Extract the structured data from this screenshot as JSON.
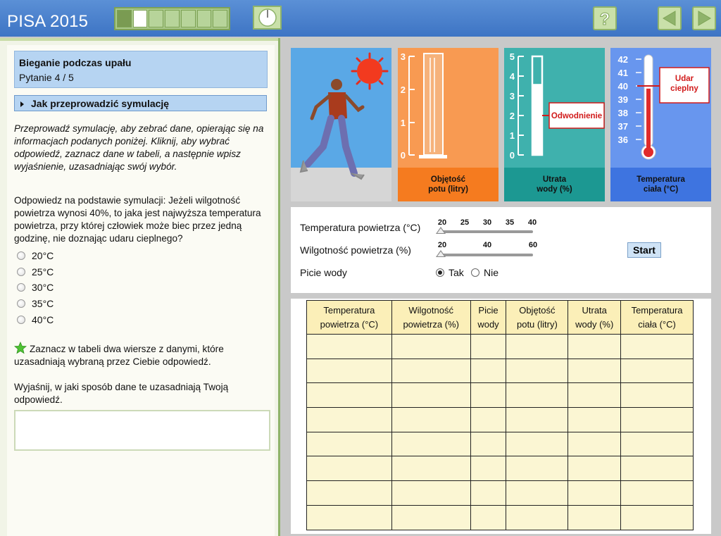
{
  "header": {
    "app_title": "PISA 2015",
    "progress": {
      "total_segments": 7,
      "completed": 1,
      "current": 2
    }
  },
  "left": {
    "title": "Bieganie podczas upału",
    "question_counter": "Pytanie 4 / 5",
    "howto_label": "Jak przeprowadzić symulację",
    "instructions": "Przeprowadź symulację, aby zebrać dane, opierając się na informacjach podanych poniżej. Kliknij, aby wybrać odpowiedź, zaznacz dane w tabeli, a następnie wpisz wyjaśnienie, uzasadniając swój wybór.",
    "question": "Odpowiedz na podstawie symulacji: Jeżeli wilgotność powietrza wynosi 40%, to jaka jest najwyższa temperatura powietrza, przy której człowiek może biec przez jedną godzinę, nie doznając udaru cieplnego?",
    "options": [
      "20°C",
      "25°C",
      "30°C",
      "35°C",
      "40°C"
    ],
    "star_note": "Zaznacz w tabeli dwa wiersze z danymi, które uzasadniają wybraną przez Ciebie odpowiedź.",
    "explain_prompt": "Wyjaśnij, w jaki sposób dane te uzasadniają Twoją odpowiedź.",
    "answer_value": ""
  },
  "gauges": {
    "sweat": {
      "label_1": "Objętość",
      "label_2": "potu (litry)",
      "ticks": [
        "0",
        "1",
        "2",
        "3"
      ]
    },
    "water": {
      "label_1": "Utrata",
      "label_2": "wody (%)",
      "ticks": [
        "0",
        "1",
        "2",
        "3",
        "4",
        "5"
      ],
      "warning_label": "Odwodnienie",
      "warning_level": 2,
      "fill_level": 3.6
    },
    "temp": {
      "label_1": "Temperatura",
      "label_2": "ciała (°C)",
      "ticks": [
        "36",
        "37",
        "38",
        "39",
        "40",
        "41",
        "42"
      ],
      "warning_label_1": "Udar",
      "warning_label_2": "cieplny",
      "warning_level": 40,
      "fill_level": 39.8
    }
  },
  "controls": {
    "air_temp_label": "Temperatura powietrza (°C)",
    "air_temp_ticks": [
      "20",
      "25",
      "30",
      "35",
      "40"
    ],
    "air_temp_value": 20,
    "humidity_label": "Wilgotność powietrza (%)",
    "humidity_ticks": [
      "20",
      "40",
      "60"
    ],
    "humidity_value": 20,
    "drink_label": "Picie wody",
    "drink_yes": "Tak",
    "drink_no": "Nie",
    "drink_selected": "Tak",
    "start_label": "Start"
  },
  "table": {
    "headers": [
      [
        "Temperatura",
        "powietrza (°C)"
      ],
      [
        "Wilgotność",
        "powietrza (%)"
      ],
      [
        "Picie",
        "wody"
      ],
      [
        "Objętość",
        "potu (litry)"
      ],
      [
        "Utrata",
        "wody (%)"
      ],
      [
        "Temperatura",
        "ciała (°C)"
      ]
    ],
    "rows": [
      [
        "",
        "",
        "",
        "",
        "",
        ""
      ],
      [
        "",
        "",
        "",
        "",
        "",
        ""
      ],
      [
        "",
        "",
        "",
        "",
        "",
        ""
      ],
      [
        "",
        "",
        "",
        "",
        "",
        ""
      ],
      [
        "",
        "",
        "",
        "",
        "",
        ""
      ],
      [
        "",
        "",
        "",
        "",
        "",
        ""
      ],
      [
        "",
        "",
        "",
        "",
        "",
        ""
      ],
      [
        "",
        "",
        "",
        "",
        "",
        ""
      ]
    ]
  },
  "colors": {
    "header": "#3d74c4",
    "accent_green": "#8fb36a",
    "table_header": "#fbefb8",
    "table_cell": "#fbf6d3",
    "warning": "#d11a1a"
  }
}
